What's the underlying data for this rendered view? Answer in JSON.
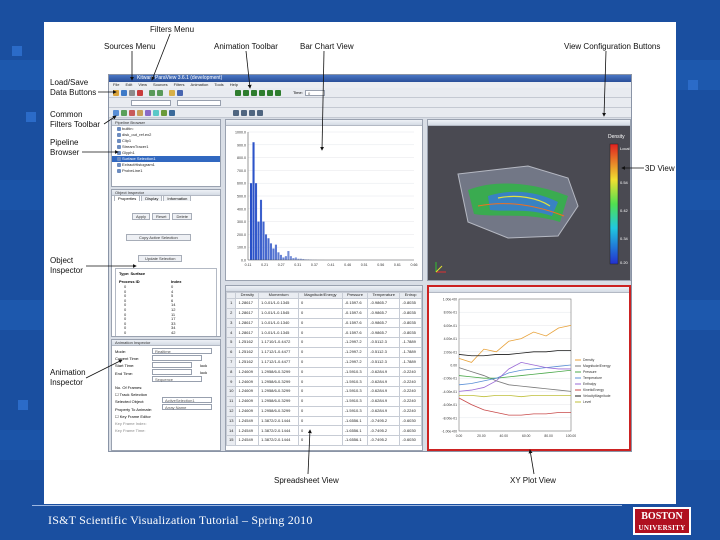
{
  "footer": {
    "course": "IS&T Scientific Visualization Tutorial – Spring 2010"
  },
  "logo": {
    "line1": "BOSTON",
    "line2": "UNIVERSITY"
  },
  "callouts": {
    "filters_menu": "Filters Menu",
    "sources_menu": "Sources Menu",
    "animation_toolbar": "Animation Toolbar",
    "bar_chart_view": "Bar Chart View",
    "view_config_buttons": "View Configuration Buttons",
    "load_save_line1": "Load/Save",
    "load_save_line2": "Data Buttons",
    "common_filters_line1": "Common",
    "common_filters_line2": "Filters Toolbar",
    "pipeline_line1": "Pipeline",
    "pipeline_line2": "Browser",
    "view_3d": "3D View",
    "object_inspector_line1": "Object",
    "object_inspector_line2": "Inspector",
    "animation_inspector_line1": "Animation",
    "animation_inspector_line2": "Inspector",
    "spreadsheet_view": "Spreadsheet View",
    "xy_plot_view": "XY Plot View"
  },
  "app": {
    "title": "Kitware ParaView 3.6.1 (development)",
    "menu": [
      "File",
      "Edit",
      "View",
      "Sources",
      "Filters",
      "Animation",
      "Tools",
      "Help"
    ],
    "time_label": "Time:",
    "time_value": "0",
    "pipeline": {
      "title": "Pipeline Browser",
      "items": [
        "builtin:",
        "disk_out_ref.ex2",
        "Clip1",
        "StreamTracer1",
        "Glyph1",
        "Surface Selection1",
        "ExtractHistogram1",
        "ProbeLine1"
      ]
    },
    "object_inspector": {
      "title": "Object Inspector",
      "tabs": [
        "Properties",
        "Display",
        "Information"
      ],
      "apply": "Apply",
      "reset": "Reset",
      "delete": "Delete",
      "copy_selection": "Copy Active Selection",
      "update_selection": "Update Selection",
      "type_label": "Type: Surface",
      "col_process": "Process ID",
      "col_index": "Index",
      "process_ids": [
        "0",
        "0",
        "0",
        "0",
        "0",
        "0",
        "0",
        "0",
        "0",
        "0",
        "0",
        "0",
        "0",
        "0",
        "0",
        "0",
        "0"
      ],
      "indices": [
        "0",
        "4",
        "5",
        "6",
        "14",
        "12",
        "11",
        "17",
        "33",
        "34",
        "42",
        "40",
        "43",
        "45",
        "41",
        "46",
        "56"
      ]
    },
    "animation_inspector": {
      "title": "Animation Inspector",
      "mode_label": "Mode:",
      "mode_value": "Realtime",
      "current_time": "Current Time:",
      "start_time": "Start Time:",
      "end_time": "End Time:",
      "lock": "lock",
      "play_mode": "Sequence",
      "no_frames": "No. Of Frames:",
      "track_selection": "Track Selection",
      "selected_object": "Selected Object:",
      "selected_object_value": "ActiveSelection1",
      "property_label": "Property To Animate:",
      "property_value": "Array Name",
      "keyframe_editor": "Key Frame Editor",
      "key_frame_index": "Key Frame Index:",
      "key_frame_time": "Key Frame Time:"
    },
    "bar_chart": {
      "ylabels": [
        "1000.0",
        "900.0",
        "800.0",
        "700.0",
        "600.0",
        "500.0",
        "400.0",
        "300.0",
        "200.0",
        "100.0",
        "0.0"
      ],
      "xlabels": [
        "0.11",
        "0.21",
        "0.27",
        "0.31",
        "0.37",
        "0.41",
        "0.46",
        "0.51",
        "0.56",
        "0.61",
        "0.66"
      ],
      "values": [
        600,
        920,
        600,
        300,
        470,
        300,
        200,
        170,
        130,
        90,
        120,
        60,
        40,
        20,
        30,
        70,
        30,
        15,
        20,
        10,
        10,
        8,
        5,
        5,
        3,
        2,
        2,
        1,
        1,
        1
      ]
    },
    "view_3d": {
      "legend_title": "Density",
      "legend_top": "Local",
      "legend_ticks": [
        "0.54",
        "0.42",
        "0.34",
        "0.20"
      ]
    },
    "spreadsheet": {
      "headers": [
        "",
        "Density",
        "Momentum",
        "Magnitude/Energy",
        "Pressure",
        "Temperature",
        "Entrop"
      ],
      "rows": [
        [
          "1",
          "1.28617",
          "1.0-01/1-0.1345",
          "0",
          "-0.1597.6",
          "-0.9865.7",
          "-0.8035"
        ],
        [
          "2",
          "1.28617",
          "1.0-01/1-0.1545",
          "0",
          "-0.1597.6",
          "-0.9865.7",
          "-0.8035"
        ],
        [
          "3",
          "1.28617",
          "1.0-01/1-0.1340",
          "0",
          "-0.1597.6",
          "-0.9865.7",
          "-0.8035"
        ],
        [
          "4",
          "1.28617",
          "1.0-01/1-0.1345",
          "0",
          "-0.1597.6",
          "-0.9865.7",
          "-0.8035"
        ],
        [
          "5",
          "1.25162",
          "1.1710/1-0.4472",
          "0",
          "-1.2997.2",
          "-0.5112.3",
          "-1.7889"
        ],
        [
          "6",
          "1.25162",
          "1.1712/1-0.4477",
          "0",
          "-1.2997.2",
          "-0.5112.3",
          "-1.7889"
        ],
        [
          "7",
          "1.25162",
          "1.1712/1-0.4477",
          "0",
          "-1.2997.2",
          "-0.5112.3",
          "-1.7889"
        ],
        [
          "8",
          "1.24609",
          "1.2958/6-0.3299",
          "0",
          "-1.5910.3",
          "-0.6284.9",
          "-0.2240"
        ],
        [
          "9",
          "1.24609",
          "1.2958/6-0.3299",
          "0",
          "-1.5910.3",
          "-0.6284.9",
          "-0.2240"
        ],
        [
          "10",
          "1.24609",
          "1.2958/6-0.3299",
          "0",
          "-1.5910.3",
          "-0.6284.9",
          "-0.2240"
        ],
        [
          "11",
          "1.24609",
          "1.2958/6-0.3299",
          "0",
          "-1.5910.3",
          "-0.6284.9",
          "-0.2240"
        ],
        [
          "12",
          "1.24609",
          "1.2958/6-0.3299",
          "0",
          "-1.5910.3",
          "-0.6284.9",
          "-0.2240"
        ],
        [
          "13",
          "1.24549",
          "1.3872/2-0.1444",
          "0",
          "-1.6556.1",
          "-0.7495.2",
          "-0.6030"
        ],
        [
          "14",
          "1.24549",
          "1.3872/2-0.1444",
          "0",
          "-1.6556.1",
          "-0.7495.2",
          "-0.6030"
        ],
        [
          "15",
          "1.24549",
          "1.3872/2-0.1444",
          "0",
          "-1.6556.1",
          "-0.7495.2",
          "-0.6030"
        ]
      ]
    },
    "xy_plot": {
      "ylabels": [
        "1.00e+00",
        "8.00e-01",
        "6.00e-01",
        "4.00e-01",
        "2.00e-01",
        "0.00",
        "-2.00e-01",
        "-4.00e-01",
        "-6.00e-01",
        "-8.00e-01",
        "-1.00e+00"
      ],
      "xlabels": [
        "0.00",
        "20.00",
        "40.00",
        "60.00",
        "80.00",
        "100.00"
      ],
      "legend": [
        "Density",
        "Magnitude/Energy",
        "Pressure",
        "Temperature",
        "Enthalpy",
        "KineticEnergy",
        "VelocityMagnitude",
        "Level"
      ],
      "series_colors": [
        "#e8a23a",
        "#7a7a7a",
        "#4aa84a",
        "#5a8fd6",
        "#9a6ad6",
        "#c84a4a",
        "#1d1d1d",
        "#bfbf3a"
      ]
    },
    "colors": {
      "accent": "#3168c0",
      "selection": "#cc2222",
      "slide_bg": "#1a4fa0"
    }
  }
}
